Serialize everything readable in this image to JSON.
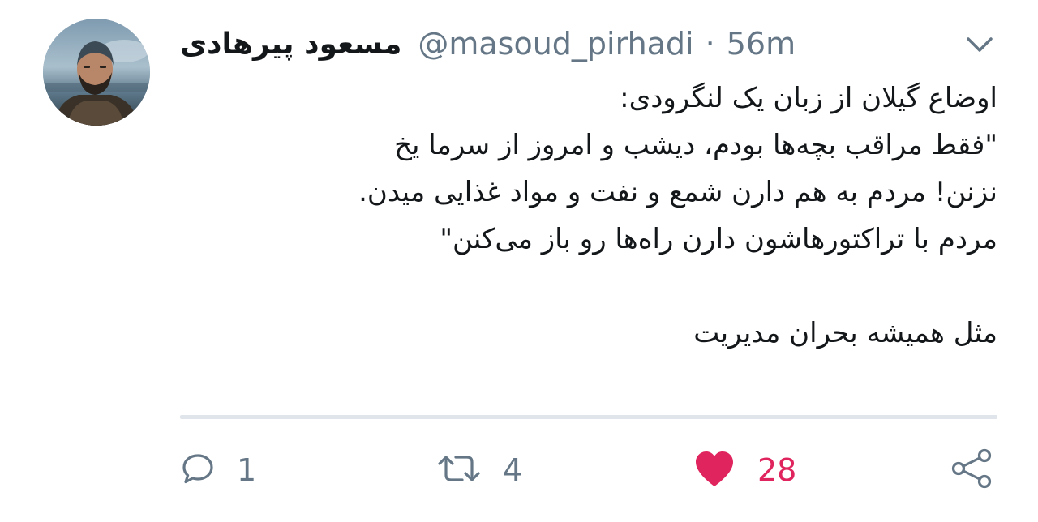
{
  "user": {
    "display_name": "مسعود پیرهادی",
    "handle": "@masoud_pirhadi",
    "separator": "·",
    "time": "56m"
  },
  "tweet": {
    "lines": [
      "اوضاع گیلان از زبان یک لنگرودی:",
      "\"فقط مراقب بچه‌ها بودم، دیشب و امروز از سرما یخ",
      "نزنن! مردم به هم دارن شمع و نفت و مواد غذایی میدن.",
      "مردم با تراکتورهاشون دارن راه‌ها رو باز می‌کنن\"",
      "",
      "مثل همیشه بحران مدیریت"
    ]
  },
  "actions": {
    "replies": "1",
    "retweets": "4",
    "likes": "28"
  },
  "icons": {
    "menu": "chevron-down-icon",
    "reply": "reply-bubble-icon",
    "retweet": "retweet-icon",
    "like": "heart-icon",
    "share": "share-icon"
  },
  "colors": {
    "text_primary": "#14171a",
    "text_secondary": "#657786",
    "like_active": "#e0245e",
    "divider": "#dfe5ea"
  }
}
